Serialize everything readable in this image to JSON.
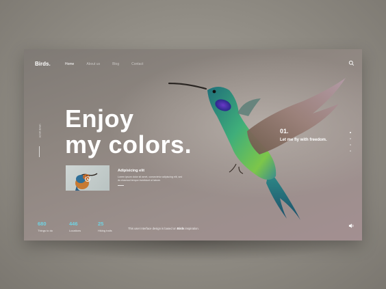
{
  "header": {
    "logo": "Birds.",
    "nav": [
      "Home",
      "About us",
      "Blog",
      "Contact"
    ],
    "active_nav": "Home"
  },
  "side": {
    "scroll_label": "scroll down"
  },
  "hero": {
    "line1": "Enjoy",
    "line2": "my colors."
  },
  "article": {
    "title": "Adipisicing elit",
    "body": "Lorem ipsum dolor sit amet, consectetur adipiscing elit, sed do eiusmod tempor incididunt ut labore."
  },
  "slide": {
    "number": "01.",
    "text": "Let me fly with freedom."
  },
  "pager": {
    "count": 4,
    "active_index": 0
  },
  "stats": [
    {
      "value": "680",
      "label": "Things to do"
    },
    {
      "value": "446",
      "label": "Locations"
    },
    {
      "value": "25",
      "label": "Hiking trails"
    }
  ],
  "footer": {
    "prefix": "This user interface design is based on",
    "brand": "Birds",
    "suffix": "inspiration."
  },
  "colors": {
    "accent": "#6fd3e4",
    "text": "#ffffff"
  },
  "icons": {
    "search": "search-icon",
    "play": "play-icon",
    "sound": "volume-icon"
  }
}
